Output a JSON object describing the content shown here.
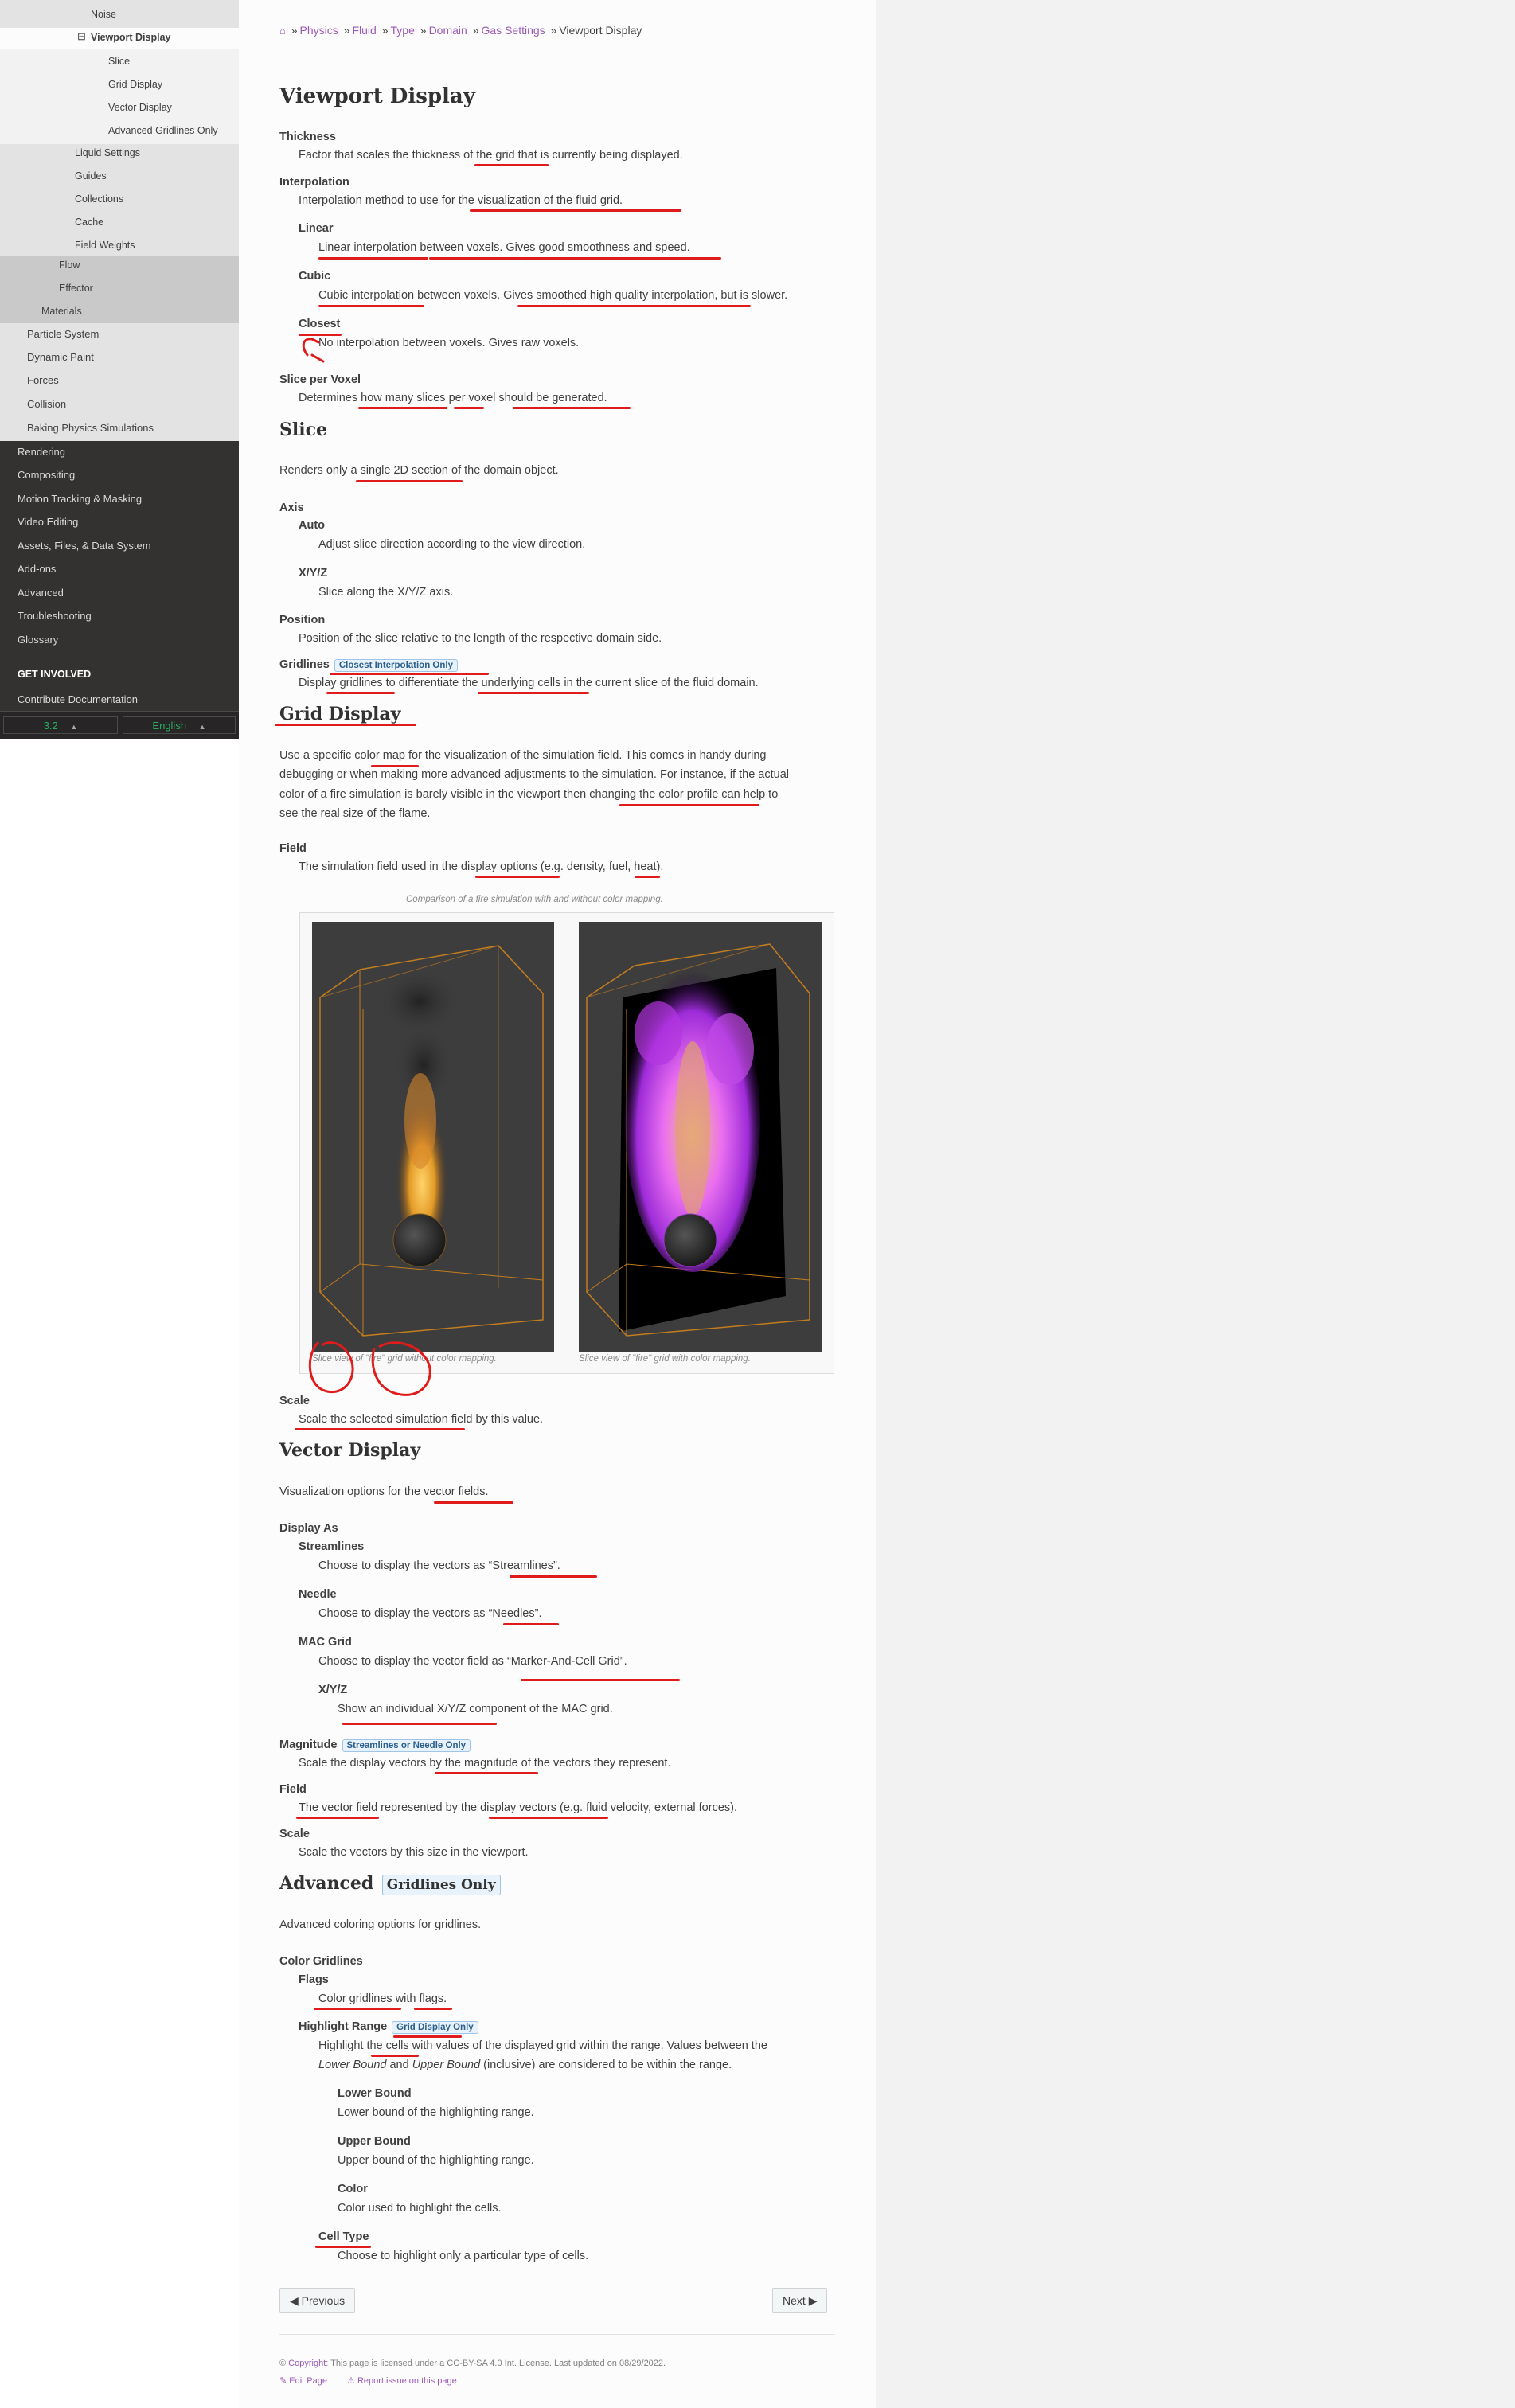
{
  "sidebar": {
    "items_light": [
      {
        "label": "Noise"
      },
      {
        "label": "Viewport Display"
      },
      {
        "label": "Slice"
      },
      {
        "label": "Grid Display"
      },
      {
        "label": "Vector Display"
      },
      {
        "label": "Advanced Gridlines Only"
      },
      {
        "label": "Liquid Settings"
      },
      {
        "label": "Guides"
      },
      {
        "label": "Collections"
      },
      {
        "label": "Cache"
      },
      {
        "label": "Field Weights"
      }
    ],
    "items_mid": [
      {
        "label": "Flow"
      },
      {
        "label": "Effector"
      },
      {
        "label": "Materials"
      }
    ],
    "items_light2": [
      {
        "label": "Particle System"
      },
      {
        "label": "Dynamic Paint"
      },
      {
        "label": "Forces"
      },
      {
        "label": "Collision"
      },
      {
        "label": "Baking Physics Simulations"
      }
    ],
    "items_dark": [
      {
        "label": "Rendering"
      },
      {
        "label": "Compositing"
      },
      {
        "label": "Motion Tracking & Masking"
      },
      {
        "label": "Video Editing"
      },
      {
        "label": "Assets, Files, & Data System"
      },
      {
        "label": "Add-ons"
      },
      {
        "label": "Advanced"
      },
      {
        "label": "Troubleshooting"
      },
      {
        "label": "Glossary"
      }
    ],
    "get_involved": "GET INVOLVED",
    "contribute": "Contribute Documentation",
    "version": "3.2",
    "language": "English",
    "collapse_glyph": "⊟"
  },
  "breadcrumb": {
    "home_icon": "home-icon",
    "items": [
      "Physics",
      "Fluid",
      "Type",
      "Domain",
      "Gas Settings"
    ],
    "current": "Viewport Display",
    "sep": "»"
  },
  "content": {
    "h_viewport": "Viewport Display",
    "thickness_dt": "Thickness",
    "thickness_dd": "Factor that scales the thickness of the grid that is currently being displayed.",
    "interp_dt": "Interpolation",
    "interp_dd": "Interpolation method to use for the visualization of the fluid grid.",
    "linear_dt": "Linear",
    "linear_dd": "Linear interpolation between voxels. Gives good smoothness and speed.",
    "cubic_dt": "Cubic",
    "cubic_dd": "Cubic interpolation between voxels. Gives smoothed high quality interpolation, but is slower.",
    "closest_dt": "Closest",
    "closest_dd": "No interpolation between voxels. Gives raw voxels.",
    "slicepv_dt": "Slice per Voxel",
    "slicepv_dd": "Determines how many slices per voxel should be generated.",
    "h_slice": "Slice",
    "slice_p": "Renders only a single 2D section of the domain object.",
    "axis_dt": "Axis",
    "auto_dt": "Auto",
    "auto_dd": "Adjust slice direction according to the view direction.",
    "xyz_dt": "X/Y/Z",
    "xyz_dd": "Slice along the X/Y/Z axis.",
    "position_dt": "Position",
    "position_dd": "Position of the slice relative to the length of the respective domain side.",
    "gridlines_dt": "Gridlines",
    "gridlines_badge": "Closest Interpolation Only",
    "gridlines_dd": "Display gridlines to differentiate the underlying cells in the current slice of the fluid domain.",
    "h_grid": "Grid Display",
    "grid_p1": "Use a specific color map for the visualization of the simulation field. This comes in handy during",
    "grid_p2": "debugging or when making more advanced adjustments to the simulation. For instance, if the actual",
    "grid_p3": "color of a fire simulation is barely visible in the viewport then changing the color profile can help to",
    "grid_p4": "see the real size of the flame.",
    "field_dt": "Field",
    "field_dd": "The simulation field used in the display options (e.g. density, fuel, heat).",
    "fig_caption": "Comparison of a fire simulation with and without color mapping.",
    "fig_left_caption": "Slice view of \"fire\" grid without color mapping.",
    "fig_right_caption": "Slice view of \"fire\" grid with color mapping.",
    "scale_dt": "Scale",
    "scale_dd": "Scale the selected simulation field by this value.",
    "h_vector": "Vector Display",
    "vector_p": "Visualization options for the vector fields.",
    "displayas_dt": "Display As",
    "stream_dt": "Streamlines",
    "stream_dd": "Choose to display the vectors as “Streamlines”.",
    "needle_dt": "Needle",
    "needle_dd": "Choose to display the vectors as “Needles”.",
    "mac_dt": "MAC Grid",
    "mac_dd": "Choose to display the vector field as “Marker-And-Cell Grid”.",
    "macxyz_dt": "X/Y/Z",
    "macxyz_dd": "Show an individual X/Y/Z component of the MAC grid.",
    "magnitude_dt": "Magnitude",
    "magnitude_badge": "Streamlines or Needle Only",
    "magnitude_dd": "Scale the display vectors by the magnitude of the vectors they represent.",
    "vfield_dt": "Field",
    "vfield_dd": "The vector field represented by the display vectors (e.g. fluid velocity, external forces).",
    "vscale_dt": "Scale",
    "vscale_dd": "Scale the vectors by this size in the viewport.",
    "h_advanced": "Advanced",
    "advanced_badge": "Gridlines Only",
    "advanced_p": "Advanced coloring options for gridlines.",
    "colorgl_dt": "Color Gridlines",
    "flags_dt": "Flags",
    "flags_dd": "Color gridlines with flags.",
    "hlrange_dt": "Highlight Range",
    "hlrange_badge": "Grid Display Only",
    "hlrange_dd1": "Highlight the cells with values of the displayed grid within the range. Values between the",
    "hlrange_dd2a": "Lower Bound",
    "hlrange_dd2b": " and ",
    "hlrange_dd2c": "Upper Bound",
    "hlrange_dd2d": " (inclusive) are considered to be within the range.",
    "lower_dt": "Lower Bound",
    "lower_dd": "Lower bound of the highlighting range.",
    "upper_dt": "Upper Bound",
    "upper_dd": "Upper bound of the highlighting range.",
    "color_dt": "Color",
    "color_dd": "Color used to highlight the cells.",
    "celltype_dt": "Cell Type",
    "celltype_dd": "Choose to highlight only a particular type of cells."
  },
  "footer": {
    "previous": "Previous",
    "next": "Next",
    "copyright_link": "Copyright",
    "copyright_text": ": This page is licensed under a CC-BY-SA 4.0 Int. License. Last updated on 08/29/2022.",
    "edit_page": "Edit Page",
    "report_issue": "Report issue on this page"
  },
  "colors": {
    "link": "#9b59b6",
    "annotation": "#e01b1b",
    "sidebar_dark": "#343131"
  }
}
